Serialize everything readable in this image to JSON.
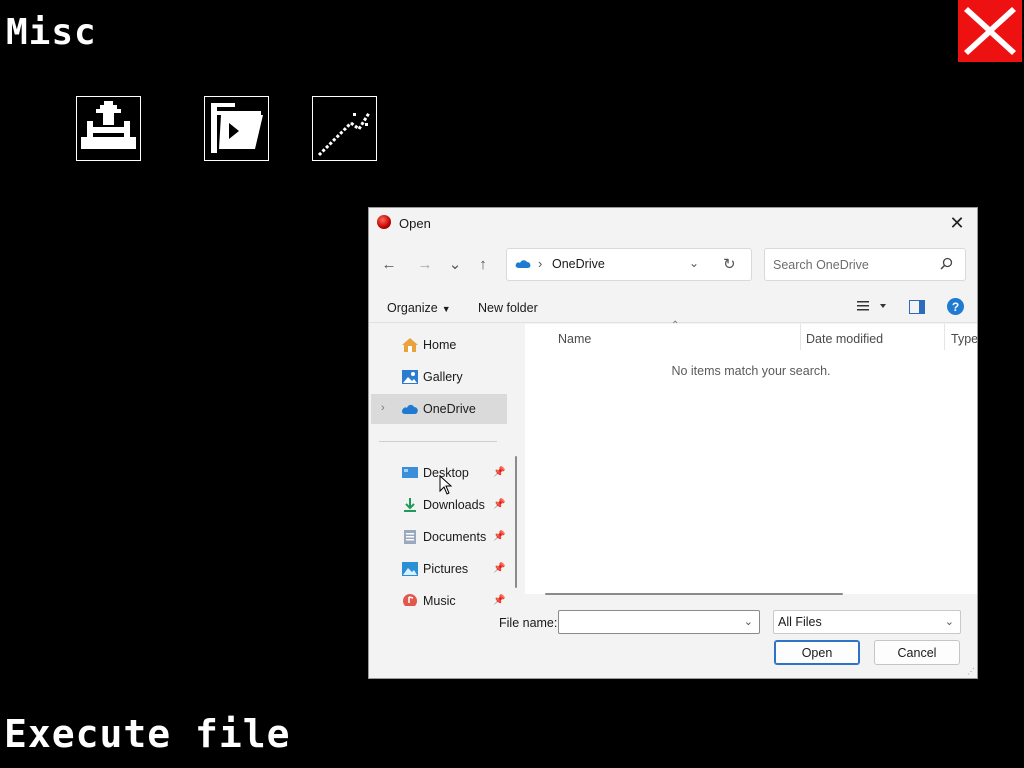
{
  "app": {
    "title": "Misc",
    "footer_caption": "Execute file",
    "close_icon": "close-icon",
    "tools": [
      {
        "icon": "upload-tray-icon"
      },
      {
        "icon": "open-folder-icon"
      },
      {
        "icon": "magic-wand-icon"
      }
    ]
  },
  "dialog": {
    "title": "Open",
    "close_glyph": "✕",
    "nav": {
      "back": "←",
      "forward": "→",
      "recent": "⌄",
      "up": "↑"
    },
    "address": {
      "separator": "›",
      "location": "OneDrive",
      "dropdown": "⌄",
      "refresh": "↻"
    },
    "search": {
      "placeholder": "Search OneDrive"
    },
    "commands": {
      "organize": "Organize",
      "new_folder": "New folder",
      "help": "?"
    },
    "sidebar": {
      "items": [
        {
          "label": "Home",
          "icon": "home-icon"
        },
        {
          "label": "Gallery",
          "icon": "gallery-icon"
        },
        {
          "label": "OneDrive",
          "icon": "onedrive-icon",
          "selected": true
        },
        {
          "label": "Desktop",
          "icon": "desktop-icon",
          "pinned": true
        },
        {
          "label": "Downloads",
          "icon": "downloads-icon",
          "pinned": true
        },
        {
          "label": "Documents",
          "icon": "documents-icon",
          "pinned": true
        },
        {
          "label": "Pictures",
          "icon": "pictures-icon",
          "pinned": true
        },
        {
          "label": "Music",
          "icon": "music-icon",
          "pinned": true
        }
      ]
    },
    "columns": [
      "Name",
      "Date modified",
      "Type"
    ],
    "empty_message": "No items match your search.",
    "filename": {
      "label": "File name:",
      "value": ""
    },
    "filetype": {
      "selected": "All Files"
    },
    "buttons": {
      "open": "Open",
      "cancel": "Cancel"
    }
  },
  "colors": {
    "close_red": "#ee1111",
    "accent_blue": "#2f73c9",
    "background": "#000000"
  }
}
